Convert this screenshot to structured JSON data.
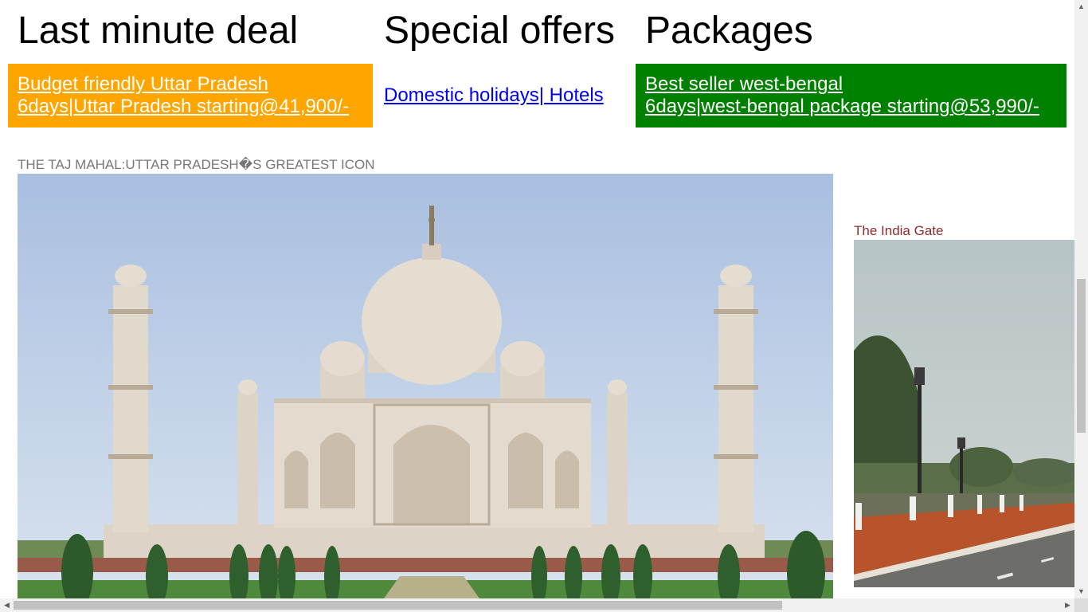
{
  "columns": {
    "left_title": "Last minute deal",
    "mid_title": "Special offers",
    "right_title": "Packages"
  },
  "deals": {
    "left_line1": "Budget friendly Uttar Pradesh",
    "left_line2": "6days|Uttar Pradesh starting@41,900/-",
    "left_color": "#ffa500",
    "mid_link": "Domestic holidays| Hotels",
    "right_line1": "Best seller west-bengal",
    "right_line2": "6days|west-bengal package starting@53,990/-",
    "right_color": "#008000"
  },
  "gallery": {
    "taj_caption": "THE TAJ MAHAL:UTTAR PRADESH�S GREATEST ICON",
    "gate_caption": "The India Gate"
  },
  "scrollbars": {
    "up": "▲",
    "down": "▼",
    "left": "◀",
    "right": "▶"
  }
}
